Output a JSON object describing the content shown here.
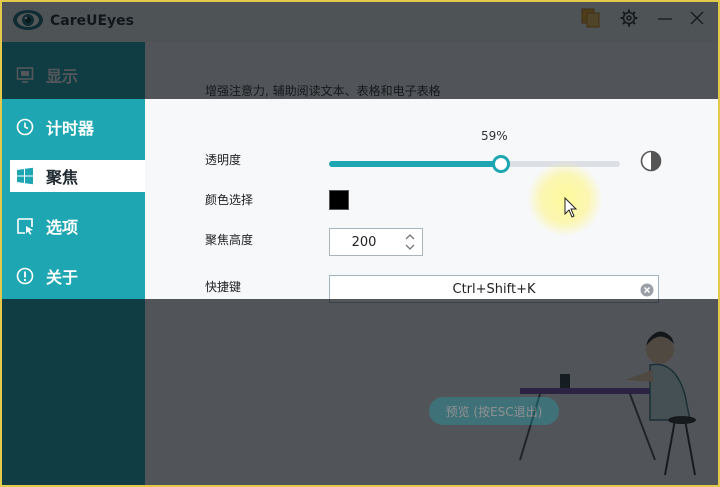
{
  "app": {
    "title": "CareUEyes"
  },
  "titlebar": {
    "buttons": [
      "pages-icon",
      "gear-icon",
      "minimize-icon",
      "close-icon"
    ]
  },
  "sidebar": {
    "items": [
      {
        "label": "显示",
        "icon": "monitor-icon",
        "active": false
      },
      {
        "label": "计时器",
        "icon": "clock-icon",
        "active": false
      },
      {
        "label": "聚焦",
        "icon": "windows-icon",
        "active": true
      },
      {
        "label": "选项",
        "icon": "select-icon",
        "active": false
      },
      {
        "label": "关于",
        "icon": "info-icon",
        "active": false
      }
    ]
  },
  "focus": {
    "description": "增强注意力, 辅助阅读文本、表格和电子表格",
    "transparency_label": "透明度",
    "transparency_percent": "59%",
    "transparency_value": 59,
    "color_label": "颜色选择",
    "color_value": "#000000",
    "height_label": "聚焦高度",
    "height_value": "200",
    "hotkey_label": "快捷键",
    "hotkey_value": "Ctrl+Shift+K",
    "preview_button": "预览 (按ESC退出)"
  },
  "colors": {
    "accent": "#1fa6b3",
    "overlay": "#0a0f14",
    "highlight": "#fff59a"
  }
}
